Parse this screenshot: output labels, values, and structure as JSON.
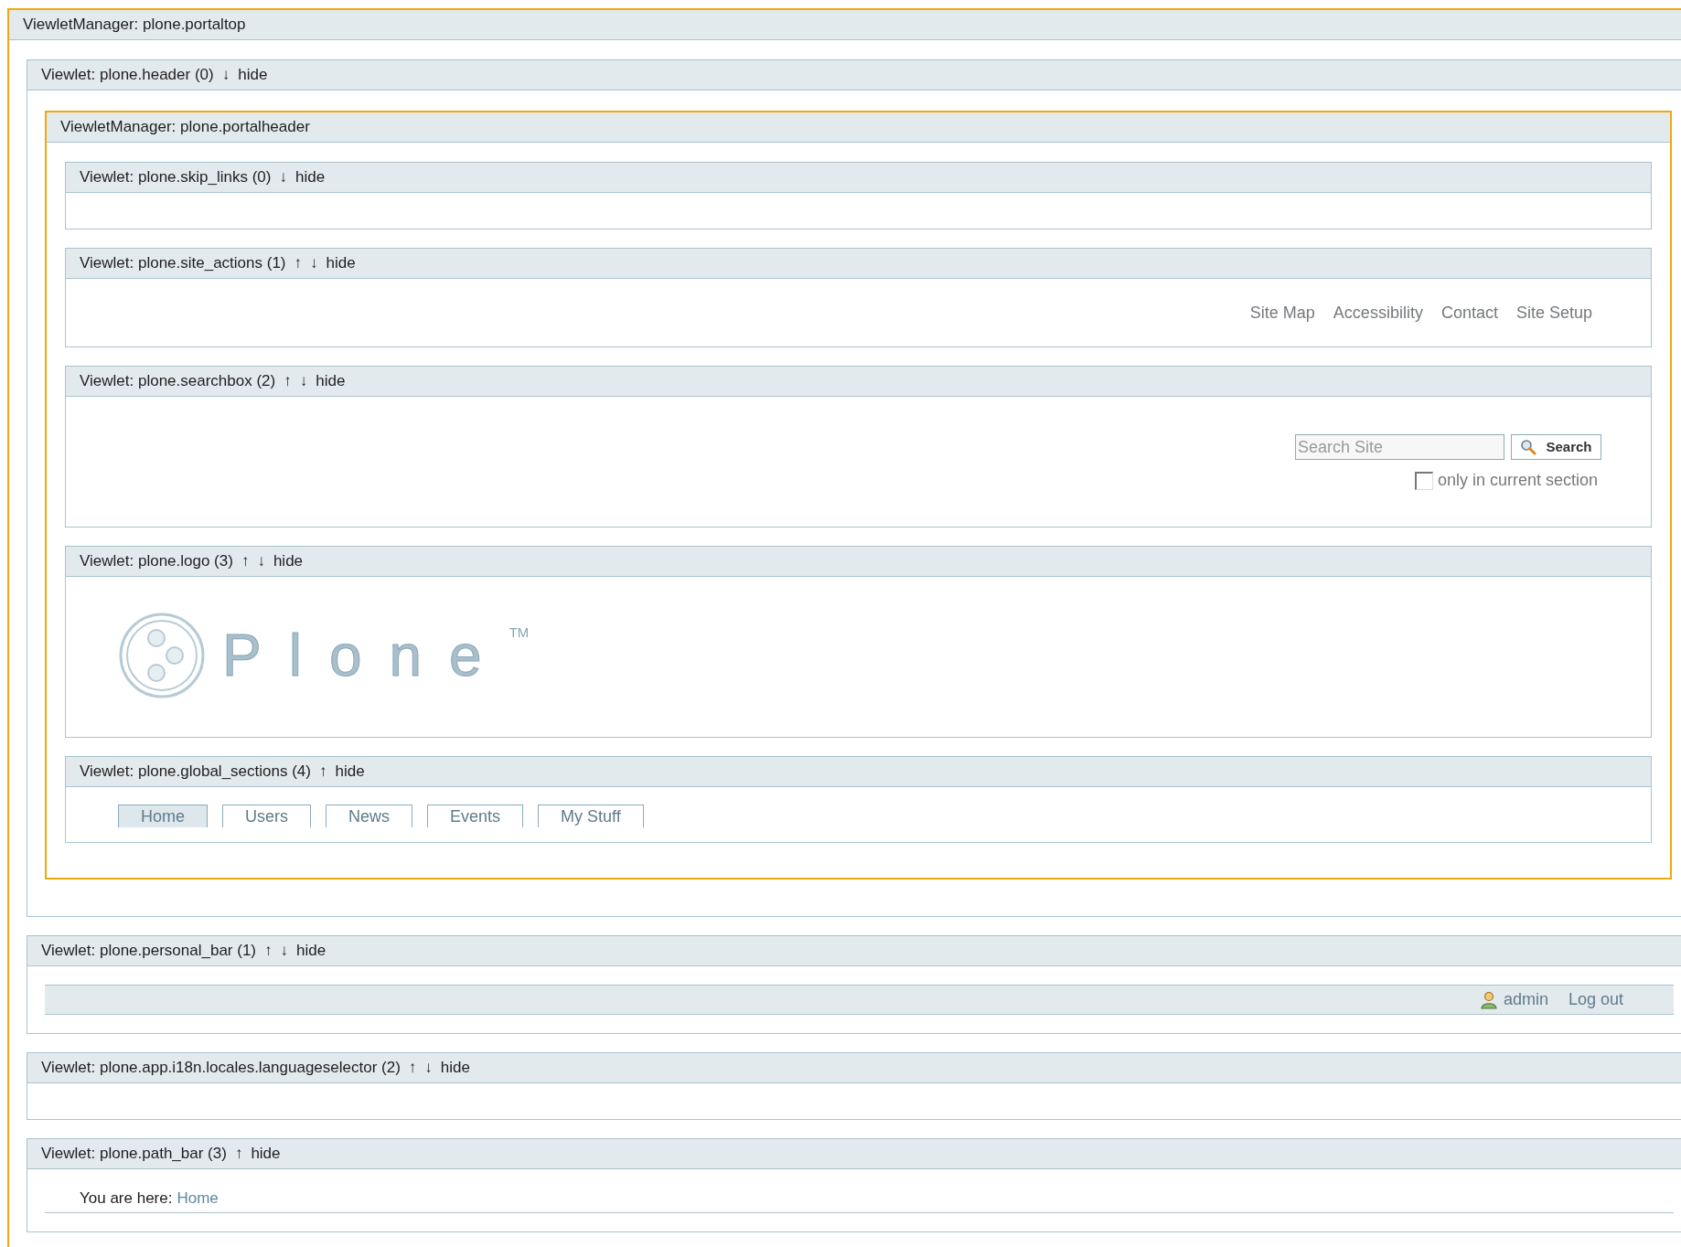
{
  "manager": {
    "title": "ViewletManager: plone.portaltop",
    "viewlets": [
      {
        "kind": "manager",
        "title": "Viewlet: plone.header (0)",
        "controls": [
          "↓",
          "hide"
        ],
        "manager": {
          "title": "ViewletManager: plone.portalheader",
          "viewlets": [
            {
              "kind": "empty",
              "title": "Viewlet: plone.skip_links (0)",
              "controls": [
                "↓",
                "hide"
              ]
            },
            {
              "kind": "site_actions",
              "title": "Viewlet: plone.site_actions (1)",
              "controls": [
                "↑",
                "↓",
                "hide"
              ],
              "links": [
                "Site Map",
                "Accessibility",
                "Contact",
                "Site Setup"
              ]
            },
            {
              "kind": "searchbox",
              "title": "Viewlet: plone.searchbox (2)",
              "controls": [
                "↑",
                "↓",
                "hide"
              ],
              "placeholder": "Search Site",
              "button": "Search",
              "checkbox": {
                "label": "only in current section",
                "checked": false
              }
            },
            {
              "kind": "logo",
              "title": "Viewlet: plone.logo (3)",
              "controls": [
                "↑",
                "↓",
                "hide"
              ],
              "logo": "Plone",
              "trademark": "TM"
            },
            {
              "kind": "global_sections",
              "title": "Viewlet: plone.global_sections (4)",
              "controls": [
                "↑",
                "hide"
              ],
              "tabs": [
                {
                  "label": "Home",
                  "selected": true
                },
                {
                  "label": "Users",
                  "selected": false
                },
                {
                  "label": "News",
                  "selected": false
                },
                {
                  "label": "Events",
                  "selected": false
                },
                {
                  "label": "My Stuff",
                  "selected": false
                }
              ]
            }
          ]
        }
      },
      {
        "kind": "personal_bar",
        "title": "Viewlet: plone.personal_bar (1)",
        "controls": [
          "↑",
          "↓",
          "hide"
        ],
        "user": "admin",
        "logout": "Log out"
      },
      {
        "kind": "empty",
        "title": "Viewlet: plone.app.i18n.locales.languageselector (2)",
        "controls": [
          "↑",
          "↓",
          "hide"
        ]
      },
      {
        "kind": "path_bar",
        "title": "Viewlet: plone.path_bar (3)",
        "controls": [
          "↑",
          "hide"
        ],
        "label": "You are here:",
        "link": "Home"
      }
    ]
  }
}
